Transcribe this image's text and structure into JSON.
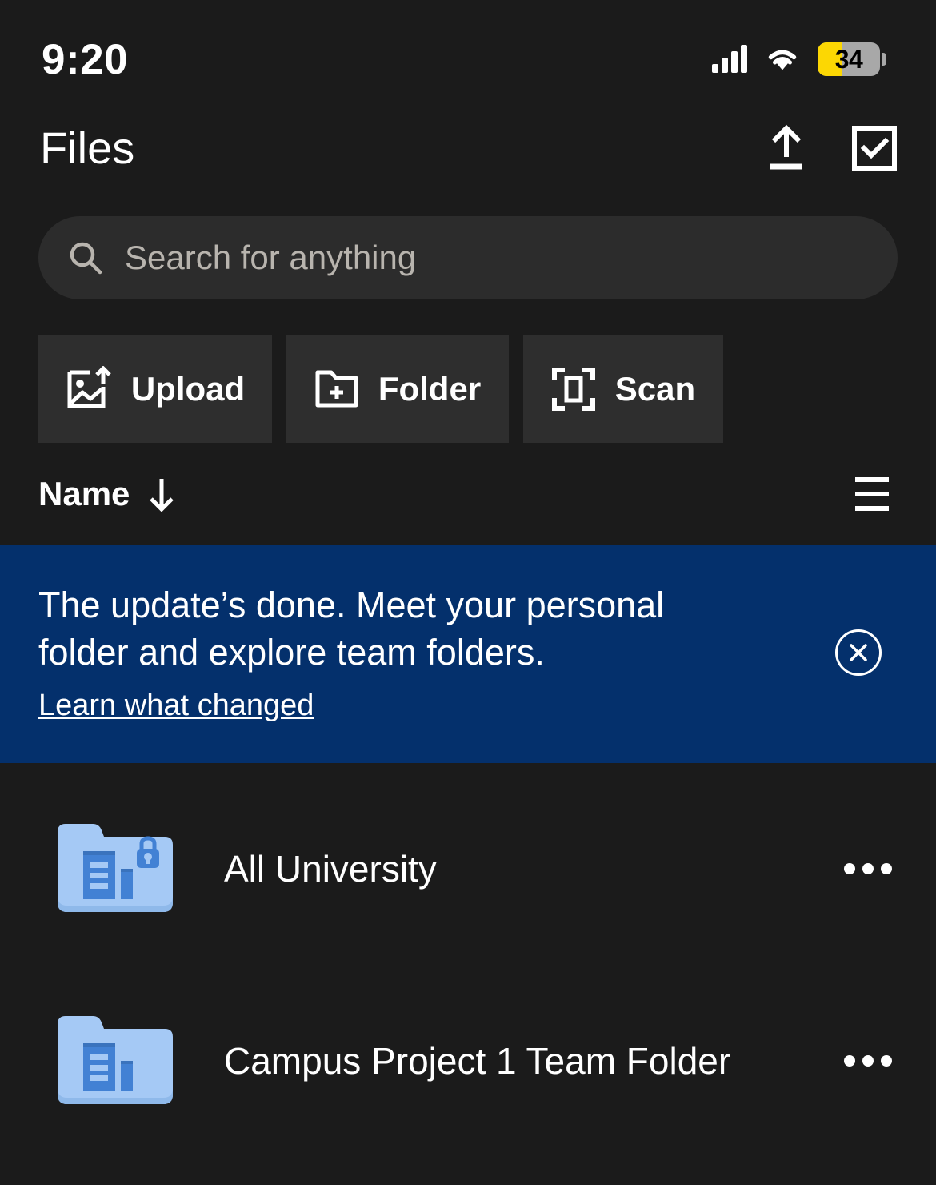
{
  "status_bar": {
    "time": "9:20",
    "signal_icon": "cellular-signal-icon",
    "wifi_icon": "wifi-icon",
    "battery_level": "34",
    "battery_icon": "battery-saver-icon"
  },
  "header": {
    "title": "Files",
    "upload_icon": "upload-icon",
    "select_icon": "checkbox-checked-icon"
  },
  "search": {
    "placeholder": "Search for anything",
    "icon": "search-icon",
    "value": ""
  },
  "quick_actions": [
    {
      "label": "Upload",
      "icon": "image-upload-icon"
    },
    {
      "label": "Folder",
      "icon": "folder-add-icon"
    },
    {
      "label": "Scan",
      "icon": "scan-document-icon"
    }
  ],
  "sort_bar": {
    "label": "Name",
    "direction_icon": "arrow-down-icon",
    "view_icon": "list-view-icon"
  },
  "banner": {
    "message": "The update’s done. Meet your personal folder and explore team folders.",
    "link_label": "Learn what changed",
    "close_icon": "close-circle-icon",
    "background_color": "#04306c"
  },
  "files": [
    {
      "name": "All University",
      "icon": "team-folder-icon",
      "locked": true,
      "overflow_icon": "more-options-icon"
    },
    {
      "name": "Campus Project 1 Team Folder",
      "icon": "team-folder-icon",
      "locked": false,
      "overflow_icon": "more-options-icon"
    }
  ],
  "colors": {
    "background": "#1b1b1b",
    "surface": "#2e2e2e",
    "accent_blue": "#04306c",
    "folder_light": "#a5c9f5",
    "folder_dark": "#4281d4",
    "battery_yellow": "#fcd703"
  }
}
